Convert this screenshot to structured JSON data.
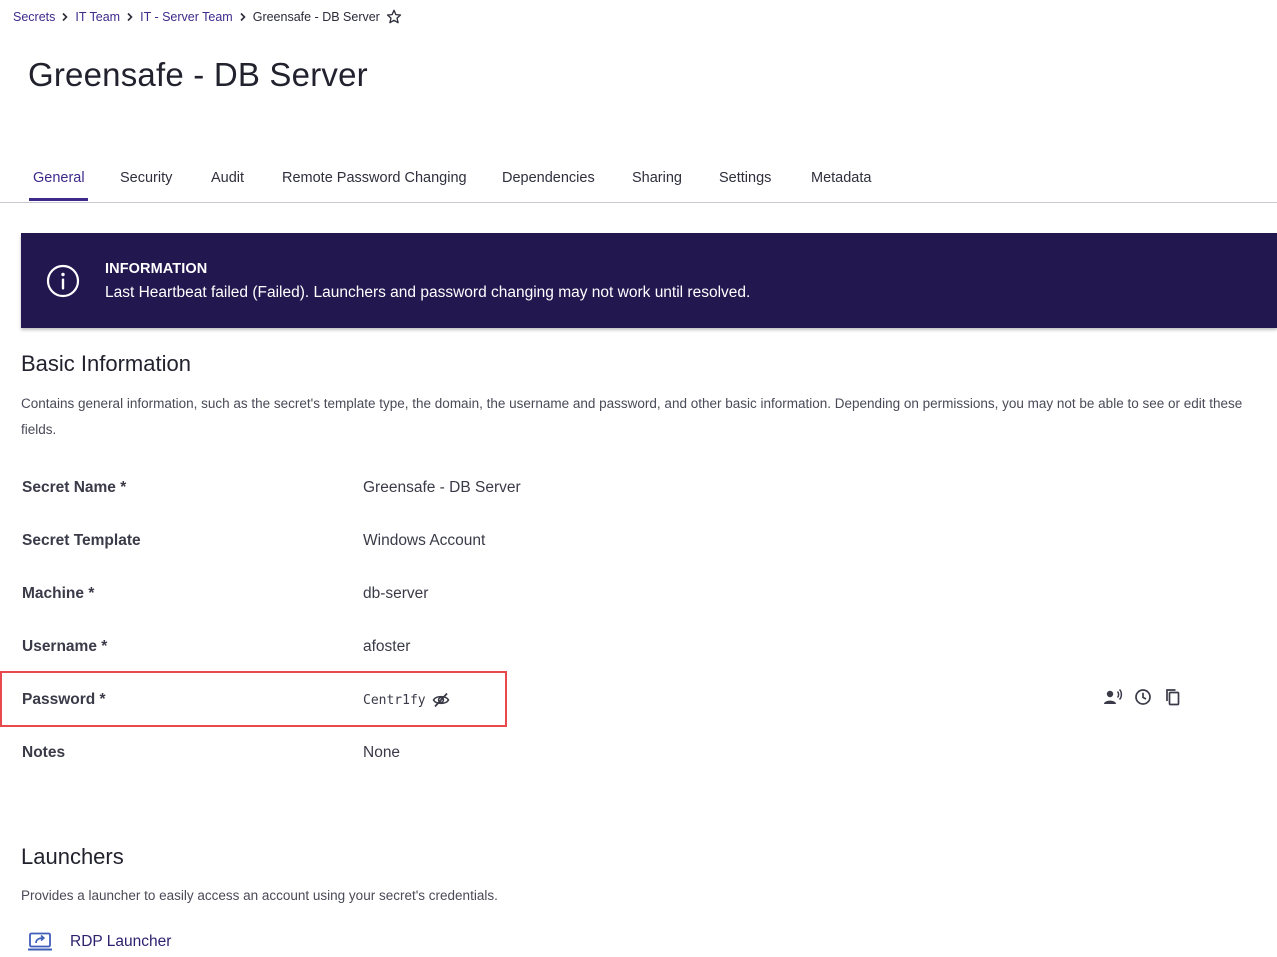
{
  "breadcrumb": {
    "items": [
      "Secrets",
      "IT Team",
      "IT - Server Team",
      "Greensafe - DB Server"
    ]
  },
  "page_title": "Greensafe - DB Server",
  "tabs": [
    {
      "label": "General",
      "active": true
    },
    {
      "label": "Security"
    },
    {
      "label": "Audit"
    },
    {
      "label": "Remote Password Changing"
    },
    {
      "label": "Dependencies"
    },
    {
      "label": "Sharing"
    },
    {
      "label": "Settings"
    },
    {
      "label": "Metadata"
    }
  ],
  "alert": {
    "title": "INFORMATION",
    "message": "Last Heartbeat failed (Failed). Launchers and password changing may not work until resolved.",
    "icon": "info-icon",
    "color": "#23174f"
  },
  "basic_info": {
    "title": "Basic Information",
    "description": "Contains general information, such as the secret's template type, the domain, the username and password, and other basic information. Depending on permissions, you may not be able to see or edit these fields.",
    "fields": [
      {
        "label": "Secret Name *",
        "value": "Greensafe - DB Server"
      },
      {
        "label": "Secret Template",
        "value": "Windows Account"
      },
      {
        "label": "Machine *",
        "value": "db-server"
      },
      {
        "label": "Username *",
        "value": "afoster"
      },
      {
        "label": "Password *",
        "value": "Centr1fy"
      },
      {
        "label": "Notes",
        "value": "None"
      }
    ],
    "password_actions": [
      "speak-password-icon",
      "history-icon",
      "copy-icon"
    ],
    "highlight_color": "#e8494d"
  },
  "launchers": {
    "title": "Launchers",
    "description": "Provides a launcher to easily access an account using your secret's credentials.",
    "items": [
      {
        "label": "RDP Launcher",
        "icon": "rdp-launcher-icon"
      }
    ]
  },
  "colors": {
    "accent": "#3f2a8c",
    "banner": "#23174f",
    "highlight": "#e8494d"
  }
}
